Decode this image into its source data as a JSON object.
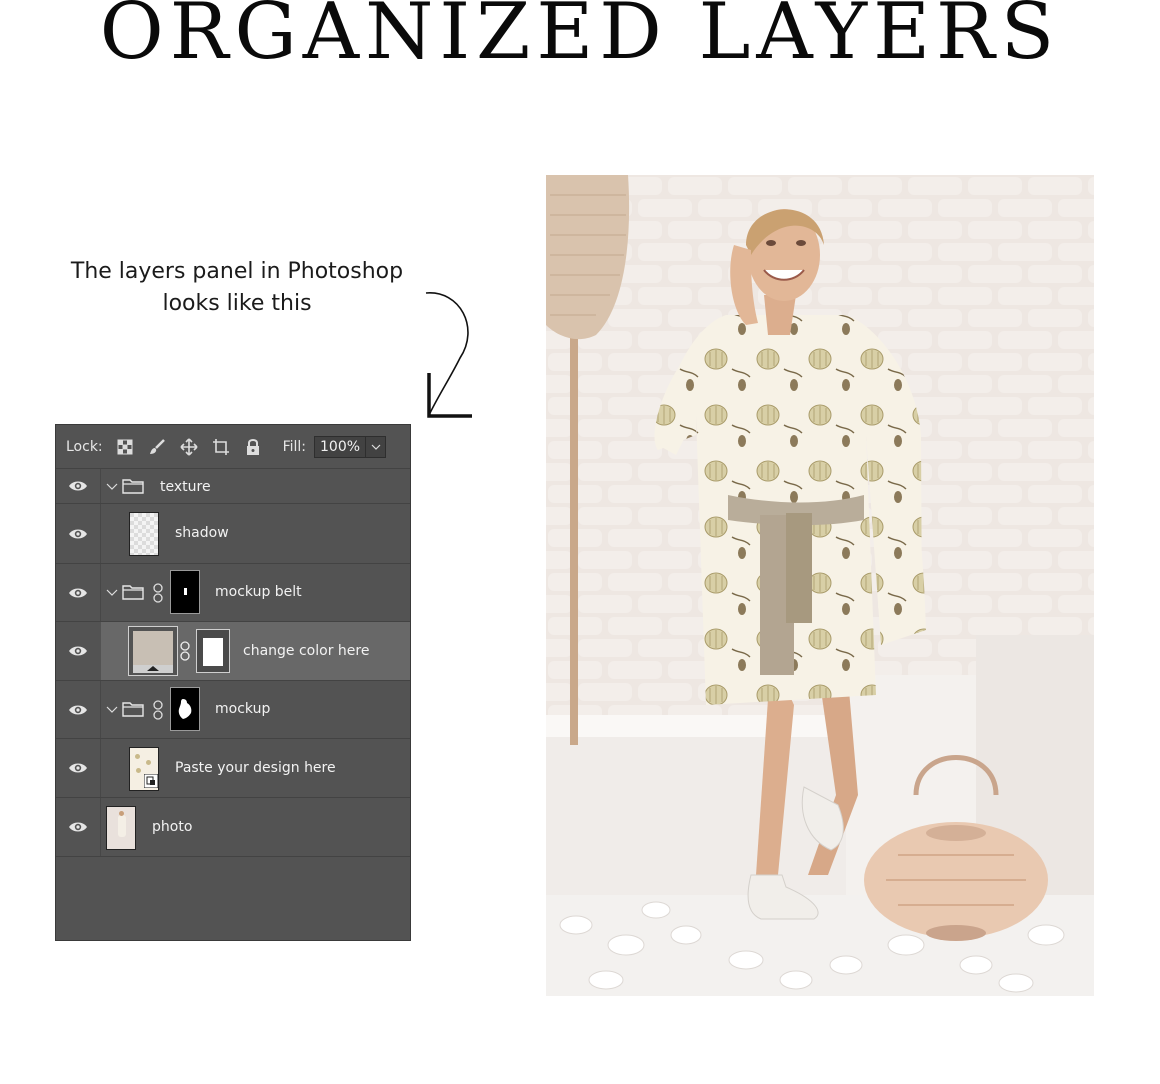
{
  "heading": "ORGANIZED LAYERS",
  "caption_line1": "The layers panel in Photoshop",
  "caption_line2": "looks like this",
  "layers_panel": {
    "lock_label": "Lock:",
    "lock_icons": [
      "lock-transparent-pixels-icon",
      "lock-image-pixels-icon",
      "lock-position-icon",
      "lock-artboard-icon",
      "lock-all-icon"
    ],
    "fill_label": "Fill:",
    "fill_value": "100%",
    "layers": [
      {
        "name": "texture",
        "kind": "group",
        "visible": true
      },
      {
        "name": "shadow",
        "kind": "layer",
        "visible": true
      },
      {
        "name": "mockup belt",
        "kind": "group-with-mask",
        "visible": true
      },
      {
        "name": "change color here",
        "kind": "fill-layer-with-mask",
        "visible": true,
        "selected": true
      },
      {
        "name": "mockup",
        "kind": "group-with-mask",
        "visible": true
      },
      {
        "name": "Paste your design here",
        "kind": "smart-object",
        "visible": true
      },
      {
        "name": "photo",
        "kind": "layer",
        "visible": true
      }
    ]
  },
  "colors": {
    "panel_bg": "#535353",
    "selected_row": "#686868",
    "swatch": "#c8bfb4"
  }
}
